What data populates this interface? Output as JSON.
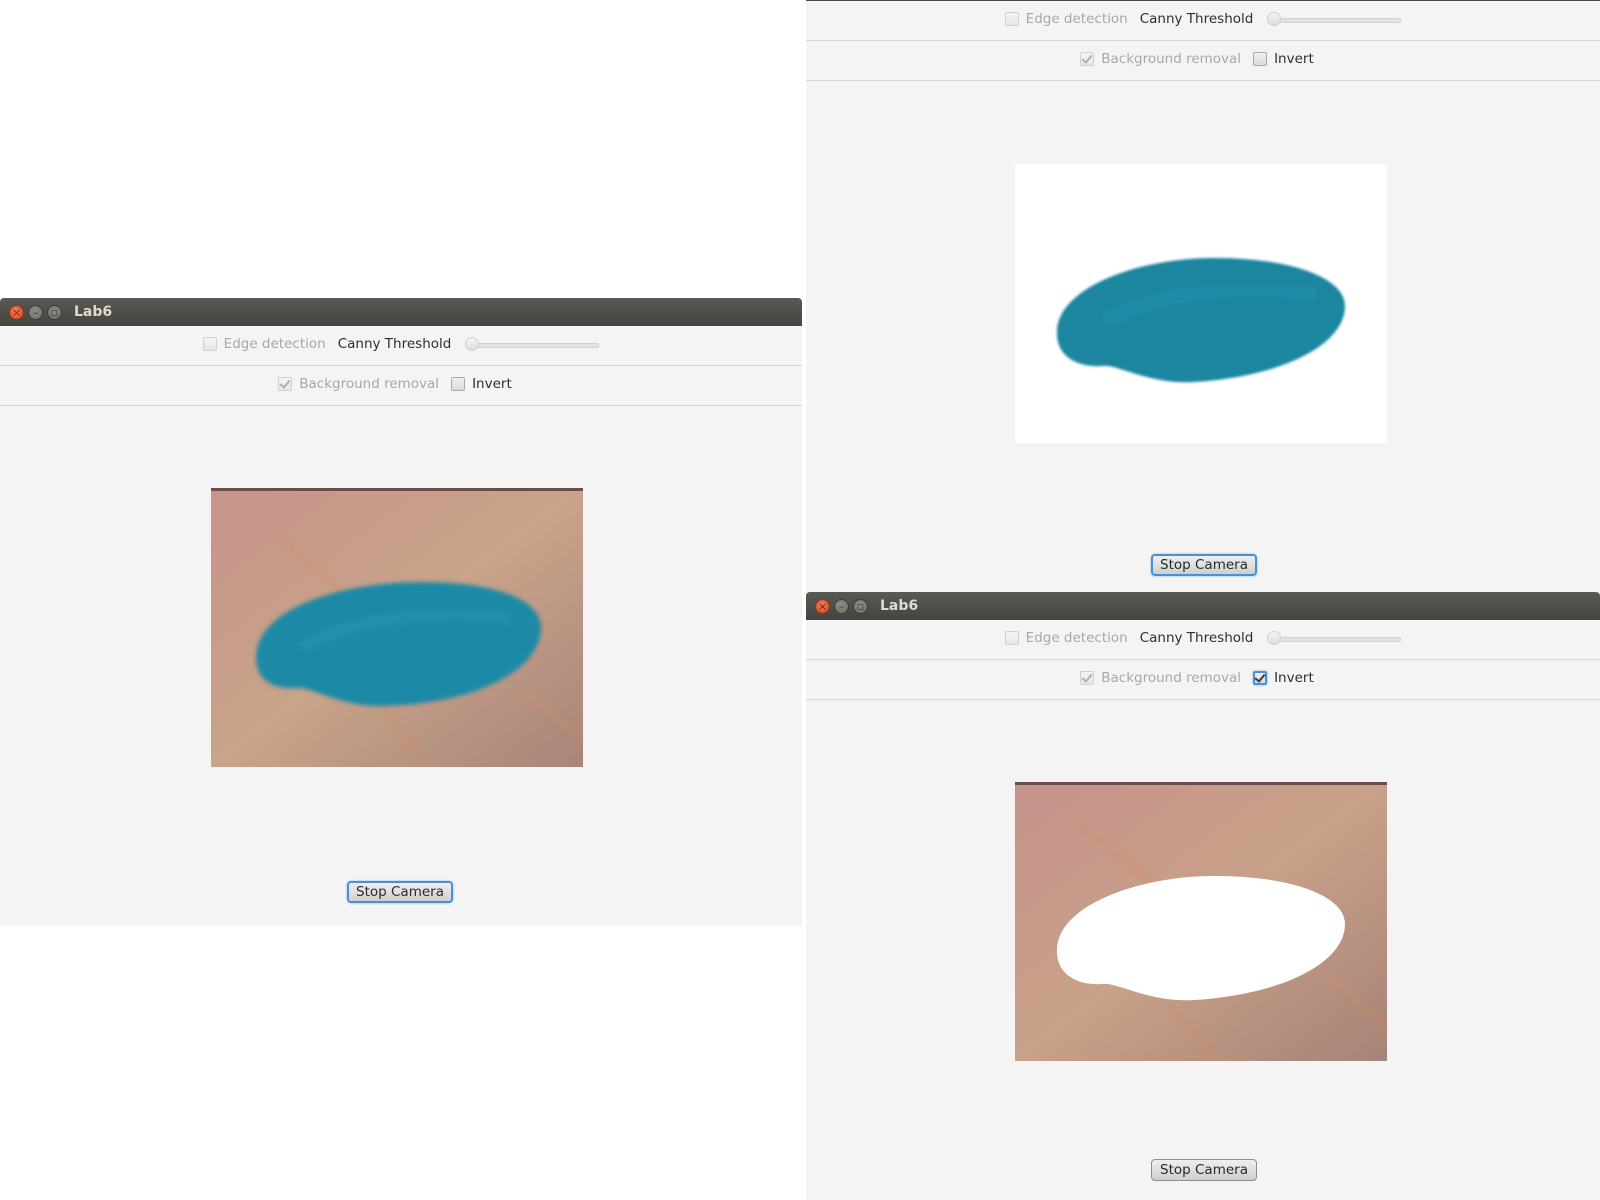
{
  "windows": [
    {
      "title": "Lab6",
      "edge_detection_label": "Edge detection",
      "canny_threshold_label": "Canny Threshold",
      "background_removal_label": "Background removal",
      "invert_label": "Invert",
      "stop_camera_label": "Stop Camera",
      "edge_detection_checked": false,
      "background_removal_checked": true,
      "invert_checked": false,
      "canny_threshold_value": 0,
      "camera_view": "raw frame with blue object on table"
    },
    {
      "title": "",
      "edge_detection_label": "Edge detection",
      "canny_threshold_label": "Canny Threshold",
      "background_removal_label": "Background removal",
      "invert_label": "Invert",
      "stop_camera_label": "Stop Camera",
      "edge_detection_checked": false,
      "background_removal_checked": true,
      "invert_checked": false,
      "canny_threshold_value": 0,
      "camera_view": "background removed, object on white"
    },
    {
      "title": "Lab6",
      "edge_detection_label": "Edge detection",
      "canny_threshold_label": "Canny Threshold",
      "background_removal_label": "Background removal",
      "invert_label": "Invert",
      "stop_camera_label": "Stop Camera",
      "edge_detection_checked": false,
      "background_removal_checked": true,
      "invert_checked": true,
      "canny_threshold_value": 0,
      "camera_view": "inverted, background kept and object removed"
    }
  ],
  "icons": {
    "close": "close-icon",
    "minimize": "minimize-icon",
    "maximize": "maximize-icon"
  },
  "colors": {
    "titlebar": "#4f4e49",
    "object_blue": "#1f8aa6",
    "table_beige": "#c49a82",
    "focus_blue": "#4a90d9"
  }
}
